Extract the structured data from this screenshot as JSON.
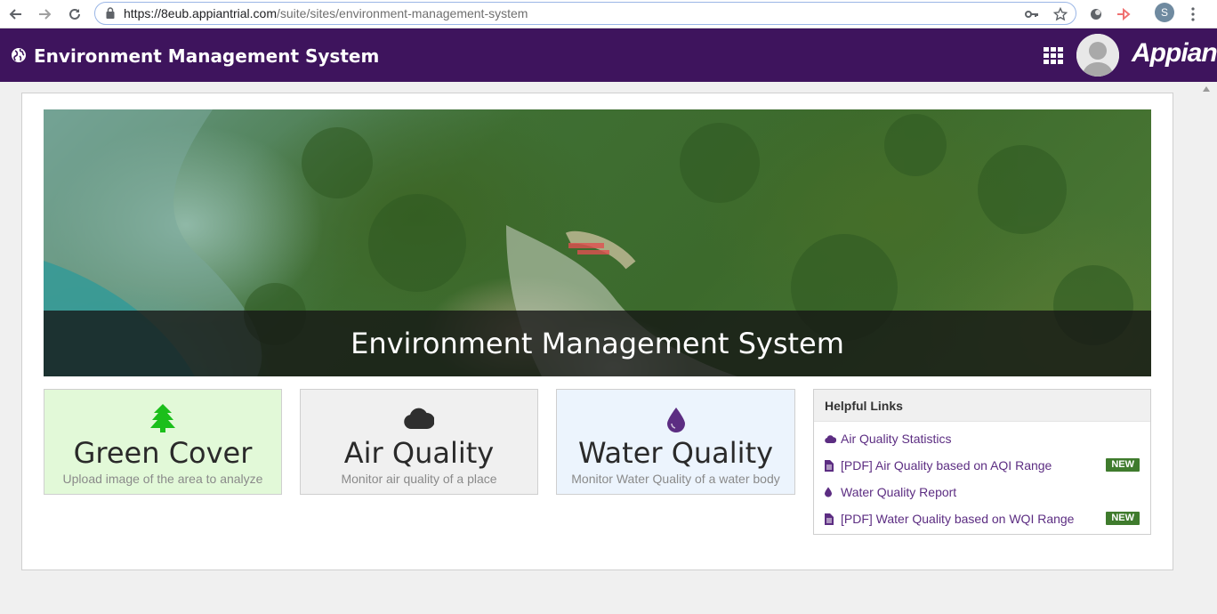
{
  "browser": {
    "url_host": "https://8eub.appiantrial.com",
    "url_path": "/suite/sites/environment-management-system",
    "profile_initial": "S",
    "icons": [
      "back-icon",
      "forward-icon",
      "reload-icon",
      "lock-icon",
      "key-icon",
      "star-icon",
      "extension-icon",
      "cast-icon",
      "menu-dots-icon"
    ]
  },
  "header": {
    "site_title": "Environment Management System",
    "brand": "Appian",
    "color": "#3e145d"
  },
  "hero": {
    "title": "Environment Management System"
  },
  "cards": [
    {
      "title": "Green Cover",
      "desc": "Upload image of the area to analyze",
      "icon": "tree-icon",
      "color": "#e2f9d8"
    },
    {
      "title": "Air Quality",
      "desc": "Monitor air quality of a place",
      "icon": "cloud-icon",
      "color": "#f0f0f0"
    },
    {
      "title": "Water Quality",
      "desc": "Monitor Water Quality of a water body",
      "icon": "water-drop-icon",
      "color": "#ecf4fd"
    }
  ],
  "helpful_links": {
    "heading": "Helpful Links",
    "items": [
      {
        "label": "Air Quality Statistics",
        "icon": "cloud-icon",
        "badge": ""
      },
      {
        "label": "[PDF] Air Quality based on AQI Range",
        "icon": "document-icon",
        "badge": "NEW"
      },
      {
        "label": "Water Quality Report",
        "icon": "water-drop-icon",
        "badge": ""
      },
      {
        "label": "[PDF] Water Quality based on WQI Range",
        "icon": "document-icon",
        "badge": "NEW"
      }
    ]
  }
}
